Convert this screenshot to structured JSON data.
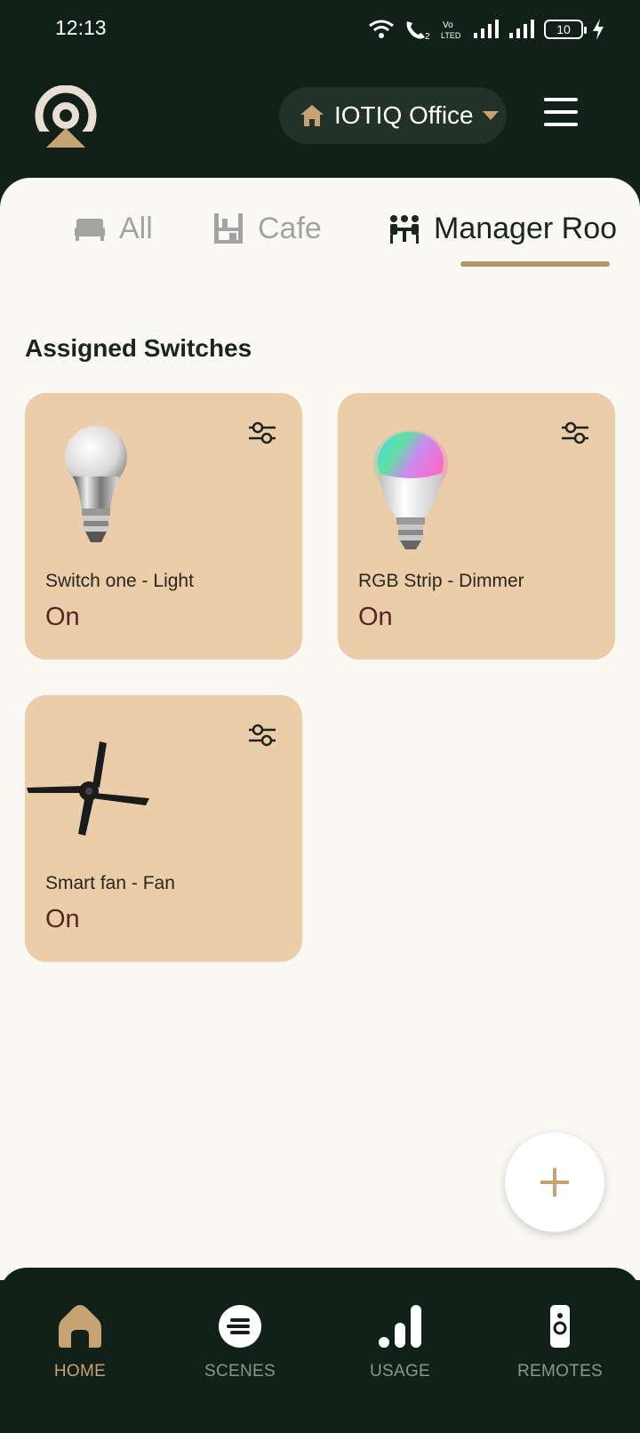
{
  "status_bar": {
    "time": "12:13",
    "battery": "10",
    "icons": [
      "wifi-icon",
      "wifi-calling-icon",
      "volte-icon",
      "signal-icon",
      "signal-icon",
      "battery-icon",
      "charging-icon"
    ]
  },
  "header": {
    "location_name": "IOTIQ Office",
    "logo_icon": "app-logo",
    "menu_icon": "hamburger-menu-icon"
  },
  "tabs": [
    {
      "label": "All",
      "icon": "bed-icon",
      "active": false
    },
    {
      "label": "Cafe",
      "icon": "cafe-shelf-icon",
      "active": false
    },
    {
      "label": "Manager Roo",
      "icon": "meeting-people-icon",
      "active": true
    }
  ],
  "section": {
    "title": "Assigned Switches"
  },
  "switches": [
    {
      "name": "Switch one - Light",
      "state": "On",
      "image": "light-bulb-image"
    },
    {
      "name": "RGB Strip - Dimmer",
      "state": "On",
      "image": "rgb-bulb-image"
    },
    {
      "name": "Smart fan - Fan",
      "state": "On",
      "image": "ceiling-fan-image"
    }
  ],
  "bottom_nav": [
    {
      "label": "HOME",
      "icon": "home-icon",
      "active": true
    },
    {
      "label": "SCENES",
      "icon": "scenes-icon",
      "active": false
    },
    {
      "label": "USAGE",
      "icon": "usage-bars-icon",
      "active": false
    },
    {
      "label": "REMOTES",
      "icon": "remote-icon",
      "active": false
    }
  ],
  "colors": {
    "dark_bg": "#12201a",
    "panel_bg": "#faf8f3",
    "card_bg": "#ebcda9",
    "accent": "#c7a273",
    "state_text": "#5a2424"
  }
}
